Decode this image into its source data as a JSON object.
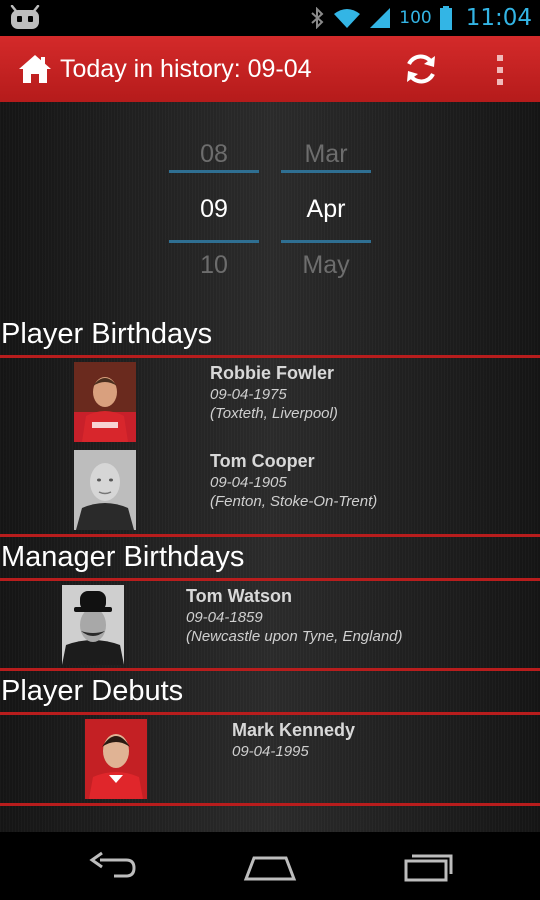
{
  "status_bar": {
    "battery": "100",
    "time": "11:04",
    "accent": "#33b5e5"
  },
  "action_bar": {
    "title": "Today in history: 09-04",
    "icons": [
      "home-icon",
      "refresh-icon",
      "overflow-menu-icon"
    ],
    "color": "#c62323"
  },
  "date_picker": {
    "day": {
      "prev": "08",
      "current": "09",
      "next": "10"
    },
    "month": {
      "prev": "Mar",
      "current": "Apr",
      "next": "May"
    }
  },
  "sections": {
    "player_birthdays": {
      "title": "Player Birthdays",
      "entries": [
        {
          "name": "Robbie Fowler",
          "date": "09-04-1975",
          "place": "(Toxteth, Liverpool)"
        },
        {
          "name": "Tom Cooper",
          "date": "09-04-1905",
          "place": "(Fenton, Stoke-On-Trent)"
        }
      ]
    },
    "manager_birthdays": {
      "title": "Manager Birthdays",
      "entries": [
        {
          "name": "Tom Watson",
          "date": "09-04-1859",
          "place": "(Newcastle upon Tyne, England)"
        }
      ]
    },
    "player_debuts": {
      "title": "Player Debuts",
      "entries": [
        {
          "name": "Mark Kennedy",
          "date": "09-04-1995"
        }
      ]
    }
  },
  "nav_bar": {
    "icons": [
      "back-icon",
      "home-icon",
      "recent-apps-icon"
    ]
  }
}
